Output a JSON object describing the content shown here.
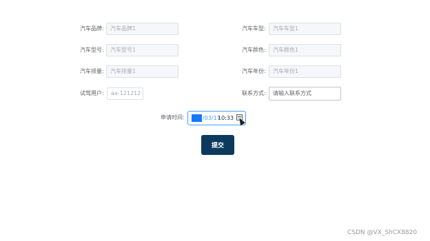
{
  "form": {
    "left": [
      {
        "label": "汽车品牌:",
        "placeholder": "汽车品牌1"
      },
      {
        "label": "汽车型号:",
        "placeholder": "汽车型号1"
      },
      {
        "label": "汽车排量:",
        "placeholder": "汽车排量1"
      },
      {
        "label": "试驾用户:",
        "placeholder": "aa-121212"
      }
    ],
    "right": [
      {
        "label": "汽车车型:",
        "placeholder": "汽车车型1"
      },
      {
        "label": "汽车颜色:",
        "placeholder": "汽车颜色1"
      },
      {
        "label": "汽车年份:",
        "placeholder": "汽车年份1"
      },
      {
        "label": "联系方式:",
        "placeholder": "请输入联系方式"
      }
    ],
    "apply_time": {
      "label": "申请时间:",
      "date_visible": "/03/17",
      "time": "10:33"
    },
    "submit_label": "提交"
  },
  "icons": {
    "calendar": "calendar-icon",
    "cursor": "mouse-pointer-icon"
  },
  "colors": {
    "accent": "#409eff",
    "submit_bg": "#0c3a5e",
    "selection": "#1677ff"
  },
  "watermark": "CSDN @VX_ShCX8820"
}
